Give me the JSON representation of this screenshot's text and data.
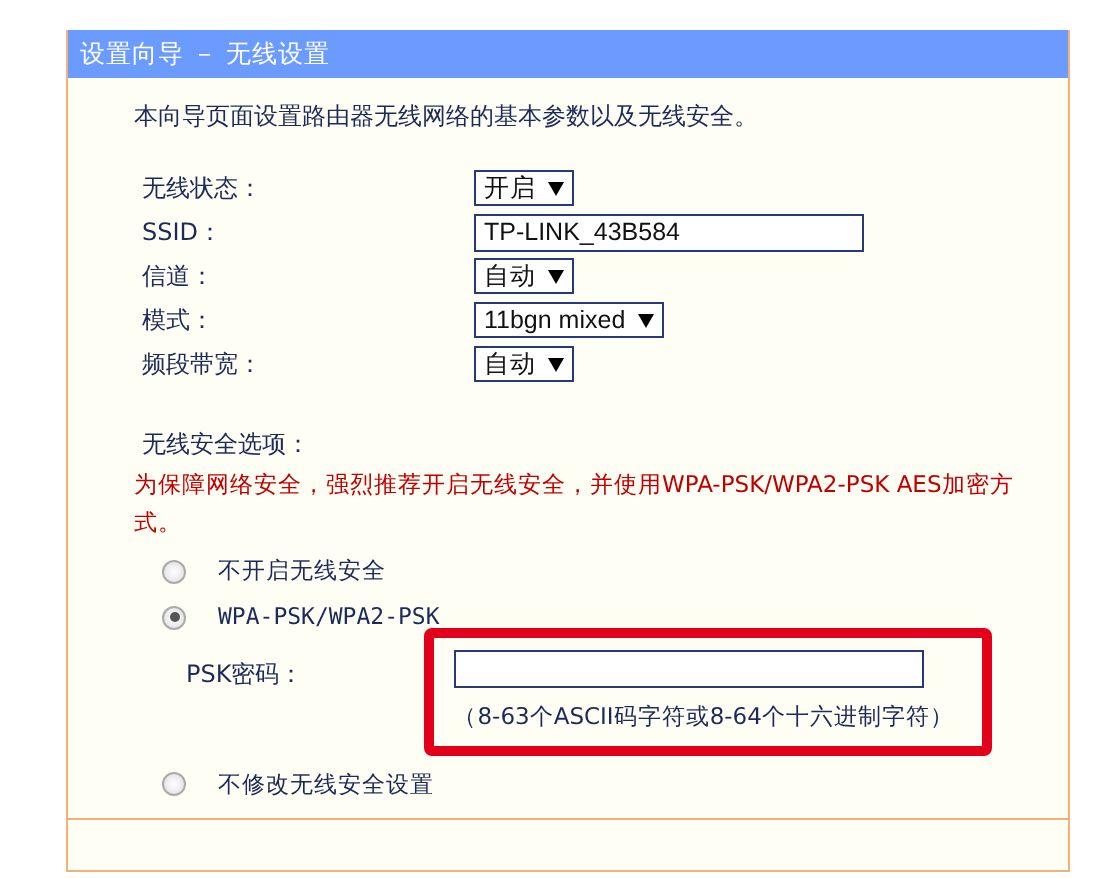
{
  "panel": {
    "title": "设置向导 － 无线设置",
    "description": "本向导页面设置路由器无线网络的基本参数以及无线安全。"
  },
  "settings": [
    {
      "label": "无线状态：",
      "kind": "select",
      "value": "开启"
    },
    {
      "label": "SSID：",
      "kind": "text",
      "value": "TP-LINK_43B584"
    },
    {
      "label": "信道：",
      "kind": "select",
      "value": "自动"
    },
    {
      "label": "模式：",
      "kind": "select",
      "value": "11bgn mixed"
    },
    {
      "label": "频段带宽：",
      "kind": "select",
      "value": "自动"
    }
  ],
  "security": {
    "label": "无线安全选项：",
    "warning": "为保障网络安全，强烈推荐开启无线安全，并使用WPA-PSK/WPA2-PSK AES加密方式。",
    "options": [
      {
        "label": "不开启无线安全",
        "selected": false
      },
      {
        "label": "WPA-PSK/WPA2-PSK",
        "selected": true,
        "psk": {
          "label": "PSK密码：",
          "highlighted": true,
          "hint": "（8-63个ASCII码字符或8-64个十六进制字符）"
        }
      },
      {
        "label": "不修改无线安全设置",
        "selected": false
      }
    ]
  }
}
